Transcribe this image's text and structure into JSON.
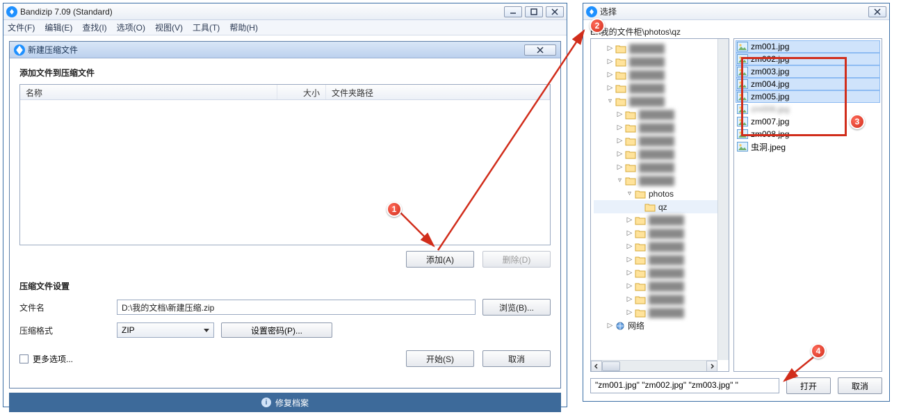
{
  "main": {
    "title": "Bandizip 7.09 (Standard)",
    "menus": [
      "文件(F)",
      "编辑(E)",
      "查找(I)",
      "选项(O)",
      "视图(V)",
      "工具(T)",
      "帮助(H)"
    ],
    "dialog": {
      "title": "新建压缩文件",
      "addTitle": "添加文件到压缩文件",
      "cols": {
        "name": "名称",
        "size": "大小",
        "path": "文件夹路径"
      },
      "addBtn": "添加(A)",
      "delBtn": "删除(D)",
      "settingsTitle": "压缩文件设置",
      "fileNameLbl": "文件名",
      "fileNameVal": "D:\\我的文档\\新建压缩.zip",
      "browseBtn": "浏览(B)...",
      "formatLbl": "压缩格式",
      "formatVal": "ZIP",
      "pwdBtn": "设置密码(P)...",
      "moreOpt": "更多选项...",
      "startBtn": "开始(S)",
      "cancelBtn": "取消"
    },
    "status": "修复档案"
  },
  "picker": {
    "title": "选择",
    "path": "E:\\我的文件柜\\photos\\qz",
    "treeVisible": {
      "photos": "photos",
      "qz": "qz",
      "network": "网络"
    },
    "files": [
      {
        "name": "zm001.jpg",
        "sel": true
      },
      {
        "name": "zm002.jpg",
        "sel": true
      },
      {
        "name": "zm003.jpg",
        "sel": true
      },
      {
        "name": "zm004.jpg",
        "sel": true
      },
      {
        "name": "zm005.jpg",
        "sel": true
      },
      {
        "name": "zm006.jpg",
        "sel": false,
        "blur": true
      },
      {
        "name": "zm007.jpg",
        "sel": false
      },
      {
        "name": "zm008.jpg",
        "sel": false
      },
      {
        "name": "虫洞.jpeg",
        "sel": false
      }
    ],
    "fileBoxVal": "\"zm001.jpg\" \"zm002.jpg\" \"zm003.jpg\" \"",
    "openBtn": "打开",
    "cancelBtn": "取消"
  },
  "callouts": {
    "1": "1",
    "2": "2",
    "3": "3",
    "4": "4"
  }
}
